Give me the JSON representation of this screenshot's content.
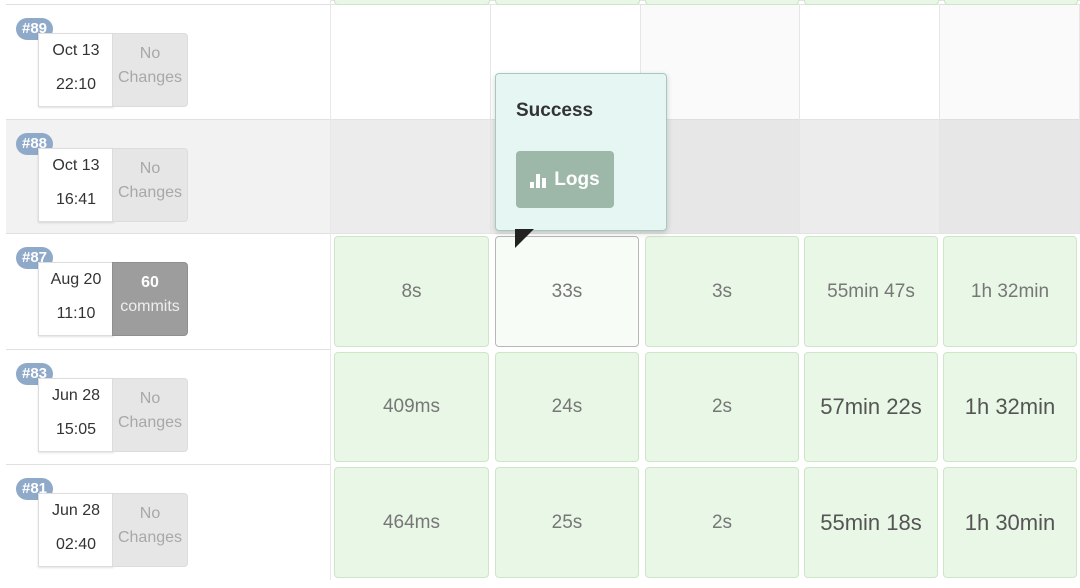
{
  "builds": [
    {
      "badge": "#89",
      "date": "Oct 13",
      "time": "22:10",
      "changes": [
        "No",
        "Changes"
      ],
      "kind": "none"
    },
    {
      "badge": "#88",
      "date": "Oct 13",
      "time": "16:41",
      "changes": [
        "No",
        "Changes"
      ],
      "kind": "none"
    },
    {
      "badge": "#87",
      "date": "Aug 20",
      "time": "11:10",
      "changes": [
        "60",
        "commits"
      ],
      "kind": "commits"
    },
    {
      "badge": "#83",
      "date": "Jun 28",
      "time": "15:05",
      "changes": [
        "No",
        "Changes"
      ],
      "kind": "none"
    },
    {
      "badge": "#81",
      "date": "Jun 28",
      "time": "02:40",
      "changes": [
        "No",
        "Changes"
      ],
      "kind": "none"
    }
  ],
  "stage_rows": [
    {
      "build": "#87",
      "cells": [
        "8s",
        "33s",
        "3s",
        "55min 47s",
        "1h 32min"
      ]
    },
    {
      "build": "#83",
      "cells": [
        "409ms",
        "24s",
        "2s",
        "57min 22s",
        "1h 32min"
      ]
    },
    {
      "build": "#81",
      "cells": [
        "464ms",
        "25s",
        "2s",
        "55min 18s",
        "1h 30min"
      ]
    }
  ],
  "popover": {
    "title": "Success",
    "button_label": "Logs",
    "button_icon": "bar-chart-icon"
  },
  "colors": {
    "success_cell": "#e9f7e6",
    "popover_bg": "#e6f7f3",
    "badge": "#8fa9c9",
    "logs_button": "#9db7a8"
  }
}
